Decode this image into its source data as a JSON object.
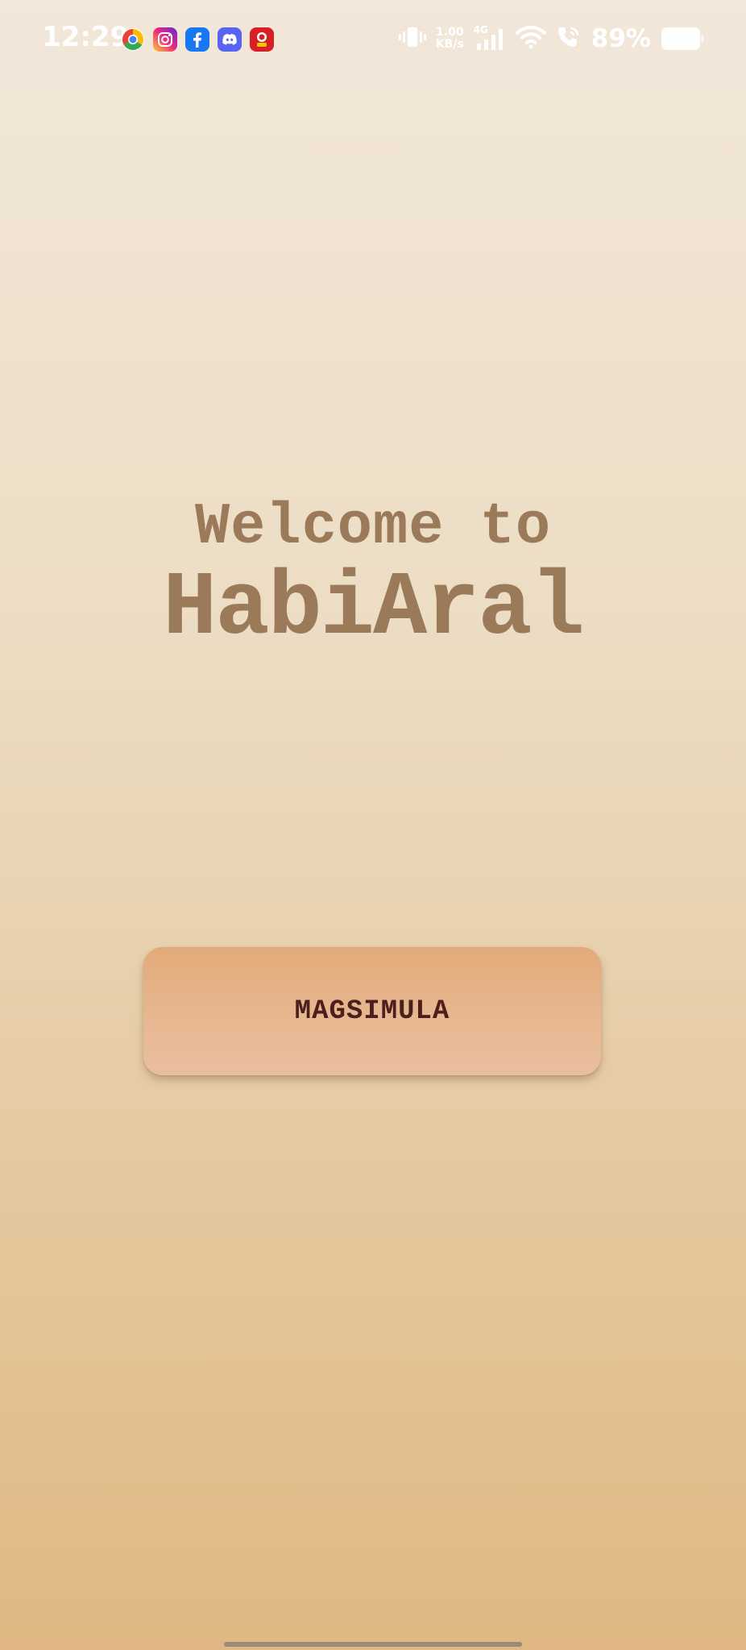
{
  "status_bar": {
    "time": "12:29",
    "notifications": [
      {
        "icon": "chrome-icon",
        "color": "#4285f4"
      },
      {
        "icon": "instagram-icon",
        "color": "#e1306c"
      },
      {
        "icon": "facebook-icon",
        "color": "#1877f2"
      },
      {
        "icon": "discord-icon",
        "color": "#5865f2"
      },
      {
        "icon": "game-app-icon",
        "color": "#e0202a"
      }
    ],
    "network_speed_value": "1.00",
    "network_speed_unit": "KB/s",
    "signal_label": "4G",
    "battery_percent": "89%"
  },
  "main": {
    "welcome_text": "Welcome to",
    "app_name": "HabiAral",
    "simulate_button_label": "MAGSIMULA"
  },
  "colors": {
    "title": "#9b7a5a",
    "button_text": "#4a1f1c",
    "button_bg": "#e6b68f"
  }
}
